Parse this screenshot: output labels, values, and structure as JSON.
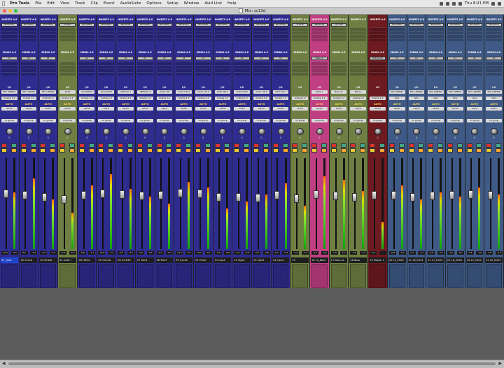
{
  "menubar": {
    "apple_icon": "apple-icon",
    "items": [
      "Pro Tools",
      "File",
      "Edit",
      "View",
      "Track",
      "Clip",
      "Event",
      "AudioSuite",
      "Options",
      "Setup",
      "Window",
      "Avid Link",
      "Help"
    ],
    "clock": "Thu 8:21 PM"
  },
  "window": {
    "title": "Mix: sc13d"
  },
  "labels": {
    "inserts": "INSERTS A-E",
    "sends": "SENDS A-E",
    "io": "I/O",
    "auto": "AUTO",
    "group": "no group",
    "pan_l": "pan",
    "pan_r": "0"
  },
  "colors": {
    "blue_strip": "#2f2c8f",
    "green_strip": "#6f7f44",
    "pink_strip": "#c03f83",
    "red_strip": "#6d1a21",
    "slate_strip": "#3f5a86",
    "meter_green": "#0ba60b",
    "selected_name": "#1f45c9"
  },
  "strips": [
    {
      "name": "01 _Kick",
      "color": "blue",
      "insert": "BLCSawil",
      "send": "A1",
      "input": "MIC LINEIN1",
      "output": "Analog 1-2",
      "vol": "-10.3",
      "peak": "-3.0",
      "selected": true
    },
    {
      "name": "02 SnrUp",
      "color": "blue",
      "insert": "BLCSawil",
      "send": "A1",
      "input": "MIC LINEIN2",
      "output": "Analog 1-2",
      "vol": "0.0",
      "peak": "-3.3",
      "selected": false
    },
    {
      "name": "03 SnrDw",
      "color": "blue",
      "insert": "BLCSawil",
      "send": "A1",
      "input": "MIC LINEIN3",
      "output": "Analog 1-2",
      "vol": "-2.8",
      "peak": "-4.4",
      "selected": false
    },
    {
      "name": "04 ambt r",
      "color": "green",
      "insert": "D-Verb",
      "send": "",
      "input": "ambt",
      "output": "Analog 1-2",
      "vol": "-6.6",
      "peak": "-5.4",
      "selected": false
    },
    {
      "name": "04 HiHat",
      "color": "blue",
      "insert": "BLCSawil",
      "send": "A1",
      "input": "aboutLRV4",
      "output": "Analog 1-2",
      "vol": "-8.8",
      "peak": "-1.7",
      "selected": false
    },
    {
      "name": "05 OvrhdL",
      "color": "blue",
      "insert": "BLCSawil",
      "send": "A1",
      "input": "aboutLRV5",
      "output": "Analog 1-2",
      "vol": "-10.8",
      "peak": "-3.3",
      "selected": false
    },
    {
      "name": "06 OvrhdR",
      "color": "blue",
      "insert": "BLCSawil",
      "send": "A1",
      "input": "VIRTUAL 1",
      "output": "Analog 1-2",
      "vol": "-5.6",
      "peak": "-8.3",
      "selected": false
    },
    {
      "name": "07 Tom1",
      "color": "blue",
      "insert": "BLCSawil",
      "send": "A1",
      "input": "VIRTUAL 2",
      "output": "Analog 1-2",
      "vol": "-7.8",
      "peak": "-3.9",
      "selected": false
    },
    {
      "name": "08 Tom2",
      "color": "blue",
      "insert": "BLCSawil",
      "send": "A1",
      "input": "AUXY LIR",
      "output": "Analog 1-2",
      "vol": "-3.3",
      "peak": "-8.1",
      "selected": false
    },
    {
      "name": "09 Cymbl",
      "color": "blue",
      "insert": "BLCSawil",
      "send": "A1",
      "input": "AUXY LIR 2",
      "output": "Analog 1-2",
      "vol": "-11.7",
      "peak": "-0.3",
      "selected": false
    },
    {
      "name": "10 Timbr",
      "color": "blue",
      "insert": "BLCSawil",
      "send": "A1",
      "input": "AUXY LIR 3",
      "output": "Analog 1-2",
      "vol": "-9.8",
      "peak": "-0.7",
      "selected": false
    },
    {
      "name": "11 Clps1",
      "color": "blue",
      "insert": "BLCSawil",
      "send": "A1",
      "input": "AUXY LIR 4",
      "output": "Analog 1-2",
      "vol": "-3.6",
      "peak": "-8.8",
      "selected": false
    },
    {
      "name": "12 Clps2",
      "color": "blue",
      "insert": "BLCSawil",
      "send": "A1",
      "input": "AUXY LIR 5",
      "output": "Analog 1-2",
      "vol": "-3.6",
      "peak": "-4.8",
      "selected": false
    },
    {
      "name": "13 Clps3",
      "color": "blue",
      "insert": "BLCSawil",
      "send": "A1",
      "input": "AUXY LIR 6",
      "output": "Analog 1-2",
      "vol": "-2.0",
      "peak": "-4.8",
      "selected": false
    },
    {
      "name": "14 Clps4",
      "color": "blue",
      "insert": "BLCSawil",
      "send": "A1",
      "input": "AUXY LIR 7",
      "output": "Analog 1-2",
      "vol": "-6.7",
      "peak": "-0.2",
      "selected": false
    },
    {
      "name": "15",
      "color": "green",
      "insert": "D-Verb",
      "send": "",
      "input": "",
      "output": "Analog 1-2",
      "vol": "-0.8",
      "peak": "-3.0",
      "selected": false
    },
    {
      "name": "16 14_Bass",
      "color": "pink",
      "insert": "BLCSawil",
      "send": "Bass dc",
      "input": "Bass 1",
      "output": "Analog 1-2",
      "vol": "-4.3",
      "peak": "-0.8",
      "selected": false
    },
    {
      "name": "17 Bass dc",
      "color": "green",
      "insert": "DC Ufnt",
      "send": "",
      "input": "Bass dc",
      "output": "Analog 1-2",
      "vol": "-7.9",
      "peak": "-11.7",
      "selected": false
    },
    {
      "name": "18 Bass",
      "color": "green",
      "insert": "",
      "send": "",
      "input": "Bass 1",
      "output": "Analog 1-2",
      "vol": "-3.8",
      "peak": "-1.0",
      "selected": false
    },
    {
      "name": "19 Master 1",
      "color": "red",
      "insert": "",
      "send": "PAD Ampl",
      "input": "",
      "output": "Analog 1-2",
      "vol": "0.0",
      "peak": "",
      "selected": false
    },
    {
      "name": "20 15_EG01",
      "color": "slate",
      "insert": "BLCSawil",
      "send": "A1",
      "input": "MIC LINEIN1",
      "output": "Gtrs",
      "vol": "-0.8",
      "peak": "-3.5",
      "selected": false
    },
    {
      "name": "21 16_EG01",
      "color": "slate",
      "insert": "BLCSawil",
      "send": "A1",
      "input": "MIC LINEIN2",
      "output": "Gtrs",
      "vol": "-0.7",
      "peak": "-4.7",
      "selected": false
    },
    {
      "name": "22 17_EG02",
      "color": "slate",
      "insert": "BLCSawil",
      "send": "A1",
      "input": "MIC LINEIN3",
      "output": "Gtrs",
      "vol": "-0.8",
      "peak": "-4.8",
      "selected": false
    },
    {
      "name": "23 18_EG03",
      "color": "slate",
      "insert": "BLCSawil",
      "send": "A1",
      "input": "MIC LINEIN4",
      "output": "Gtrs",
      "vol": "-3.6",
      "peak": "-0.7",
      "selected": false
    },
    {
      "name": "24 19_EG04",
      "color": "slate",
      "insert": "BLCSawil",
      "send": "A1",
      "input": "MIC LINEIN5",
      "output": "Gtrs",
      "vol": "-0.8",
      "peak": "-4.8",
      "selected": false
    },
    {
      "name": "25 20_EG05",
      "color": "slate",
      "insert": "BLCSawil",
      "send": "A1",
      "input": "MIC LINEIN6",
      "output": "Gtrs",
      "vol": "-0.8",
      "peak": "-4.4",
      "selected": false
    }
  ],
  "levels": [
    0.62,
    0.78,
    0.55,
    0.4,
    0.7,
    0.82,
    0.66,
    0.58,
    0.5,
    0.74,
    0.68,
    0.45,
    0.52,
    0.6,
    0.72,
    0.48,
    0.8,
    0.76,
    0.64,
    0.3,
    0.7,
    0.55,
    0.62,
    0.58,
    0.68,
    0.6
  ],
  "faders": [
    0.62,
    0.6,
    0.58,
    0.55,
    0.6,
    0.62,
    0.61,
    0.59,
    0.6,
    0.63,
    0.62,
    0.58,
    0.58,
    0.57,
    0.6,
    0.56,
    0.61,
    0.59,
    0.58,
    0.6,
    0.6,
    0.58,
    0.59,
    0.6,
    0.61,
    0.6
  ]
}
